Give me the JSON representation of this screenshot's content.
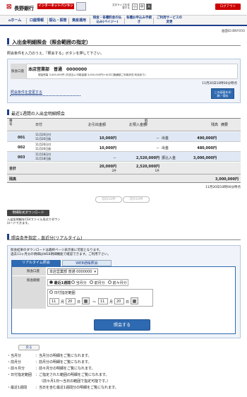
{
  "header": {
    "bank_name": "長野銀行",
    "ib_badge": "インターネットバンキング",
    "font_size_label": "文字サイズを変更する",
    "font_sizes": [
      "小",
      "中",
      "大"
    ],
    "logout": "ログアウト"
  },
  "nav": {
    "items": [
      {
        "icon": "home-icon",
        "label": "ホーム"
      },
      {
        "label": "口座情報"
      },
      {
        "label": "振込・振替"
      },
      {
        "label": "資産運用"
      },
      {
        "label": "税金・各種料金の払込み(ペイジー)"
      },
      {
        "label": "各種お申込み手続き"
      },
      {
        "label": "ご利用サービスの変更"
      }
    ]
  },
  "screen_id": "画面ID:BNY050",
  "page_title": "入出金明細照会（照会範囲の指定）",
  "instruction": "照会条件を入力のうえ、「照会する」ボタンを押して下さい。",
  "account": {
    "label": "照会口座",
    "value": "本店営業部　普通　0000000",
    "detail": "現金残高 3,000,000円 (内支払い可能金額 3,000,000円/+ACE口座繰越ご利用状況 利用あり)",
    "timestamp": "11月20日10時00分時点",
    "change_link": "照会条件を変更する",
    "print_button": "この画面を印刷・保存"
  },
  "recent": {
    "title": "最近1週間の入出金明細照会",
    "headers": {
      "no": "番号",
      "date": "日付",
      "withdraw": "お引出金額",
      "deposit": "お預入金額",
      "type": "取引",
      "balance": "残高",
      "memo": "摘要"
    },
    "rows": [
      {
        "no": "001",
        "date1": "11月20日付",
        "date2": "11月20日扱",
        "withdraw": "10,000円",
        "deposit": "－",
        "type": "出金",
        "balance": "490,000円",
        "memo": ""
      },
      {
        "no": "002",
        "date1": "11月20日付",
        "date2": "11月20日扱",
        "withdraw": "10,000円",
        "deposit": "－",
        "type": "出金",
        "balance": "480,000円",
        "memo": ""
      },
      {
        "no": "003",
        "date1": "11月18日付",
        "date2": "11月18日扱",
        "withdraw": "－",
        "deposit": "2,520,000円",
        "type": "振込入金",
        "balance": "3,000,000円",
        "memo": ""
      }
    ],
    "total_label": "合計",
    "total_withdraw": "20,000円",
    "total_withdraw_count": "2件",
    "total_deposit": "2,520,000円",
    "total_deposit_count": "1件",
    "balance_label": "残高",
    "balance_value": "3,000,000円",
    "timestamp": "11月20日10時00分時点"
  },
  "pager": {
    "prev": "前の10件",
    "next": "次の10件"
  },
  "download": {
    "button": "明細形式ダウンロード",
    "note1": "入出金明細をCSVファイル形式でダウン",
    "note2": "ロードできます。"
  },
  "search": {
    "title": "照会条件指定 - 直近分(リアルタイム)",
    "desc1": "照会結果のダウンロードは最終ページ表示後に可能となります。",
    "desc2": "過去13ヶ月分の明細はWEB明細機能で確認できます。ご利用下さい。",
    "tab_realtime": "リアルタイム照会",
    "tab_web": "WEB通帳照会",
    "account_label": "照会口座",
    "account_value": "本店営業部 普通 0000000",
    "period_label": "照会期間",
    "period_options": [
      "最近1週間",
      "当月分",
      "前月分",
      "前々月分"
    ],
    "date_range_label": "日付指定範囲",
    "from_month": "11",
    "from_day": "20",
    "to_month": "11",
    "to_day": "20",
    "unit_month": "月",
    "unit_day": "日",
    "tilde": "〜",
    "submit": "照会する"
  },
  "back": "戻る",
  "notes": [
    {
      "k": "・当月分",
      "v": "：当月分の明細をご覧になれます。"
    },
    {
      "k": "・前月分",
      "v": "：前月分の明細をご覧になれます。"
    },
    {
      "k": "・前々月分",
      "v": "：前々月分の明細をご覧になれます。"
    },
    {
      "k": "・日付指定範囲",
      "v": "：ご指定された範囲の明細をご覧になれます。"
    },
    {
      "k": "",
      "v": "（前々月1日〜当日の範囲で指定可能です。）"
    },
    {
      "k": "・最近1週間",
      "v": "：当日を含む最近1週間分の明細をご覧になれます。"
    }
  ]
}
